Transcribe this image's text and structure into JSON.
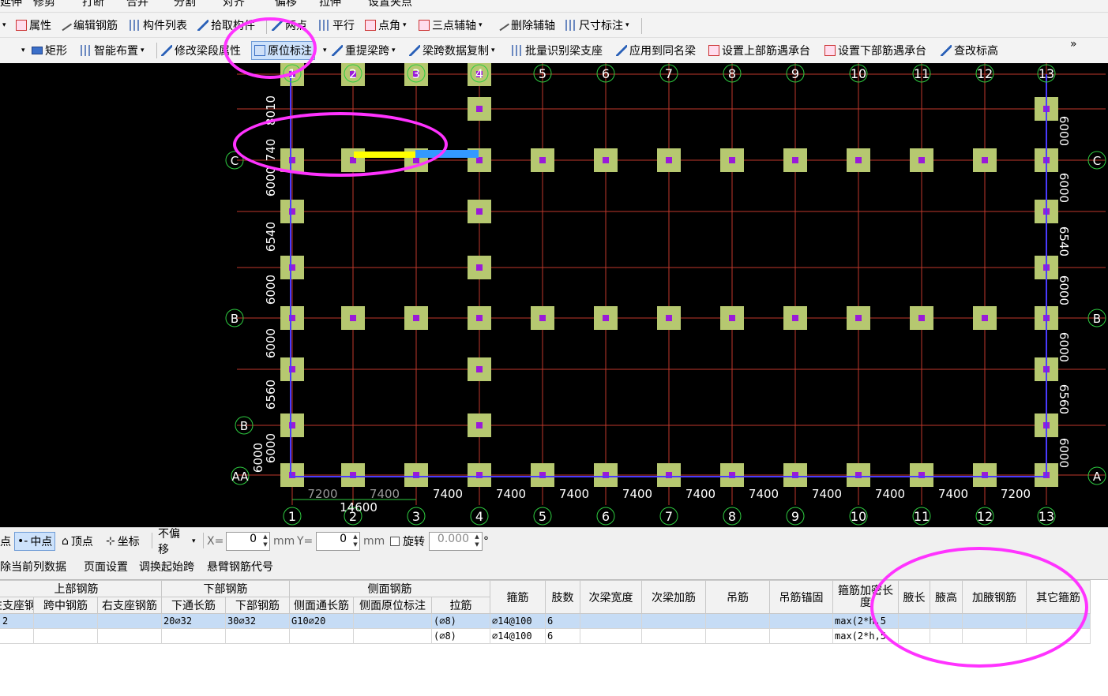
{
  "toolbar0": [
    "延伸",
    "修剪",
    "打断",
    "合并",
    "分割",
    "对齐",
    "偏移",
    "拉伸",
    "设置夹点"
  ],
  "toolbar1": {
    "items": [
      "属性",
      "编辑钢筋",
      "构件列表",
      "拾取构件",
      "两点",
      "平行",
      "点角",
      "三点辅轴",
      "删除辅轴",
      "尺寸标注"
    ]
  },
  "toolbar2": {
    "items": [
      "矩形",
      "智能布置",
      "修改梁段属性",
      "原位标注",
      "重提梁跨",
      "梁跨数据复制",
      "批量识别梁支座",
      "应用到同名梁",
      "设置上部筋遇承台",
      "设置下部筋遇承台",
      "查改标高"
    ],
    "more": "»"
  },
  "canvas": {
    "col_labels": [
      "1",
      "2",
      "3",
      "4",
      "5",
      "6",
      "7",
      "8",
      "9",
      "10",
      "11",
      "12",
      "13"
    ],
    "row_labels_left": [
      "C",
      "B",
      "B",
      "AA"
    ],
    "row_labels_right": [
      "C",
      "B",
      "A"
    ],
    "bottom_dims": [
      "7200",
      "7400",
      "7400",
      "7400",
      "7400",
      "7400",
      "7400",
      "7400",
      "7400",
      "7400",
      "7400",
      "7200"
    ],
    "bottom_total": "14600",
    "left_dims": [
      "8010",
      "740",
      "6000",
      "6540",
      "6000",
      "6000",
      "6560",
      "6000",
      "6000"
    ],
    "right_dims": [
      "6000",
      "6000",
      "6540",
      "6000",
      "6000",
      "6560",
      "6000"
    ],
    "colors": {
      "column": "#b6c870",
      "core": "#9a1ad8",
      "grid": "#c0392b",
      "beam": "#4a3bff",
      "axis_circle": "#2ecc40"
    }
  },
  "snapbar": {
    "point": "点",
    "midpoint": "中点",
    "vertex": "顶点",
    "coord": "坐标",
    "offset": "不偏移",
    "x_label": "X=",
    "x_value": "0",
    "mm1": "mm",
    "y_label": "Y=",
    "y_value": "0",
    "mm2": "mm",
    "rotate": "旋转",
    "rotate_value": "0.000",
    "degree": "°"
  },
  "tablebar": [
    "删除当前列数据",
    "页面设置",
    "调换起始跨",
    "悬臂钢筋代号"
  ],
  "table": {
    "groups": [
      "上部钢筋",
      "下部钢筋",
      "侧面钢筋"
    ],
    "single_headers": [
      "箍筋",
      "肢数",
      "次梁宽度",
      "次梁加筋",
      "吊筋",
      "吊筋锚固",
      "箍筋加密长度",
      "腋长",
      "腋高",
      "加腋钢筋",
      "其它箍筋"
    ],
    "sub_headers": [
      "左支座钢筋",
      "跨中钢筋",
      "右支座钢筋",
      "下通长筋",
      "下部钢筋",
      "侧面通长筋",
      "侧面原位标注",
      "拉筋"
    ],
    "rows": [
      [
        "2",
        "",
        "",
        "20⌀32",
        "30⌀32",
        "G10⌀20",
        "",
        "(⌀8)",
        "⌀14@100",
        "6",
        "",
        "",
        "",
        "",
        "max(2*h,5",
        "",
        "",
        "",
        ""
      ],
      [
        "",
        "",
        "",
        "",
        "",
        "",
        "",
        "(⌀8)",
        "⌀14@100",
        "6",
        "",
        "",
        "",
        "",
        "max(2*h,5",
        "",
        "",
        "",
        ""
      ]
    ]
  }
}
